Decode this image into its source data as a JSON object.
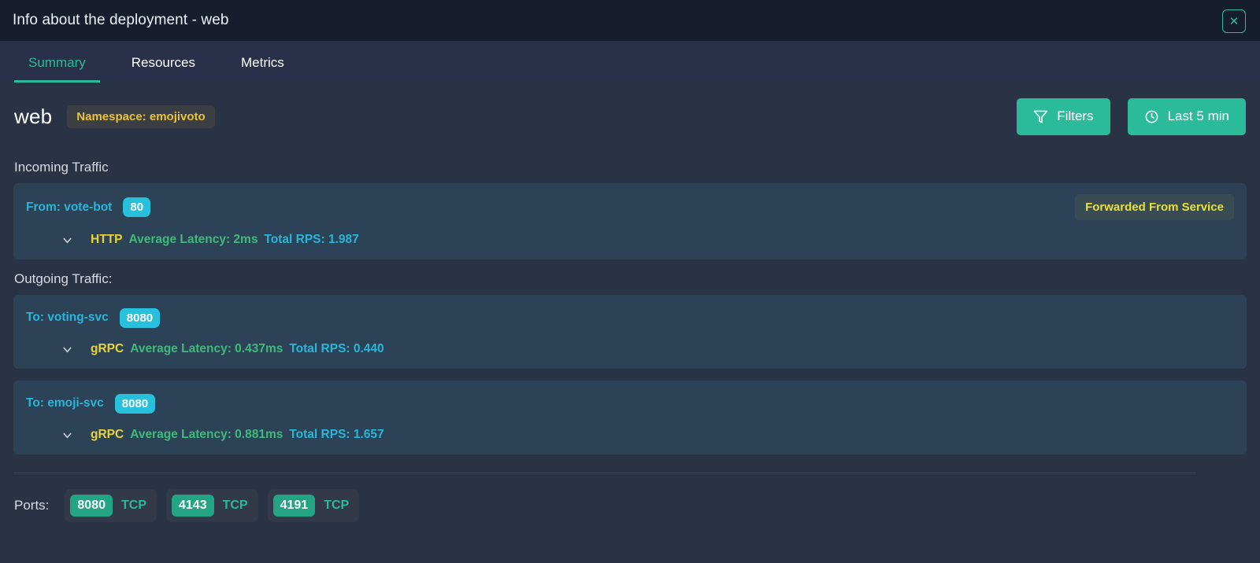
{
  "window": {
    "title": "Info about the deployment - web",
    "close_label": "✕"
  },
  "tabs": [
    {
      "label": "Summary",
      "active": true
    },
    {
      "label": "Resources",
      "active": false
    },
    {
      "label": "Metrics",
      "active": false
    }
  ],
  "header": {
    "deployment_name": "web",
    "namespace_badge": "Namespace: emojivoto",
    "filters_button": "Filters",
    "timerange_button": "Last 5 min"
  },
  "incoming": {
    "section_title": "Incoming Traffic",
    "rows": [
      {
        "peer": "From: vote-bot",
        "port": "80",
        "badge": "Forwarded From Service",
        "protocol": "HTTP",
        "latency": "Average Latency: 2ms",
        "rps": "Total RPS: 1.987"
      }
    ]
  },
  "outgoing": {
    "section_title": "Outgoing Traffic:",
    "rows": [
      {
        "peer": "To: voting-svc",
        "port": "8080",
        "protocol": "gRPC",
        "latency": "Average Latency: 0.437ms",
        "rps": "Total RPS: 0.440"
      },
      {
        "peer": "To: emoji-svc",
        "port": "8080",
        "protocol": "gRPC",
        "latency": "Average Latency: 0.881ms",
        "rps": "Total RPS: 1.657"
      }
    ]
  },
  "ports": {
    "label": "Ports:",
    "items": [
      {
        "number": "8080",
        "protocol": "TCP"
      },
      {
        "number": "4143",
        "protocol": "TCP"
      },
      {
        "number": "4191",
        "protocol": "TCP"
      }
    ]
  },
  "colors": {
    "accent_teal": "#2bbb9a",
    "cyan": "#29b6d8",
    "yellow": "#e8d43a",
    "green": "#3fba7a",
    "panel": "#2c4257",
    "background": "#2a3245",
    "titlebar": "#161e2e"
  }
}
